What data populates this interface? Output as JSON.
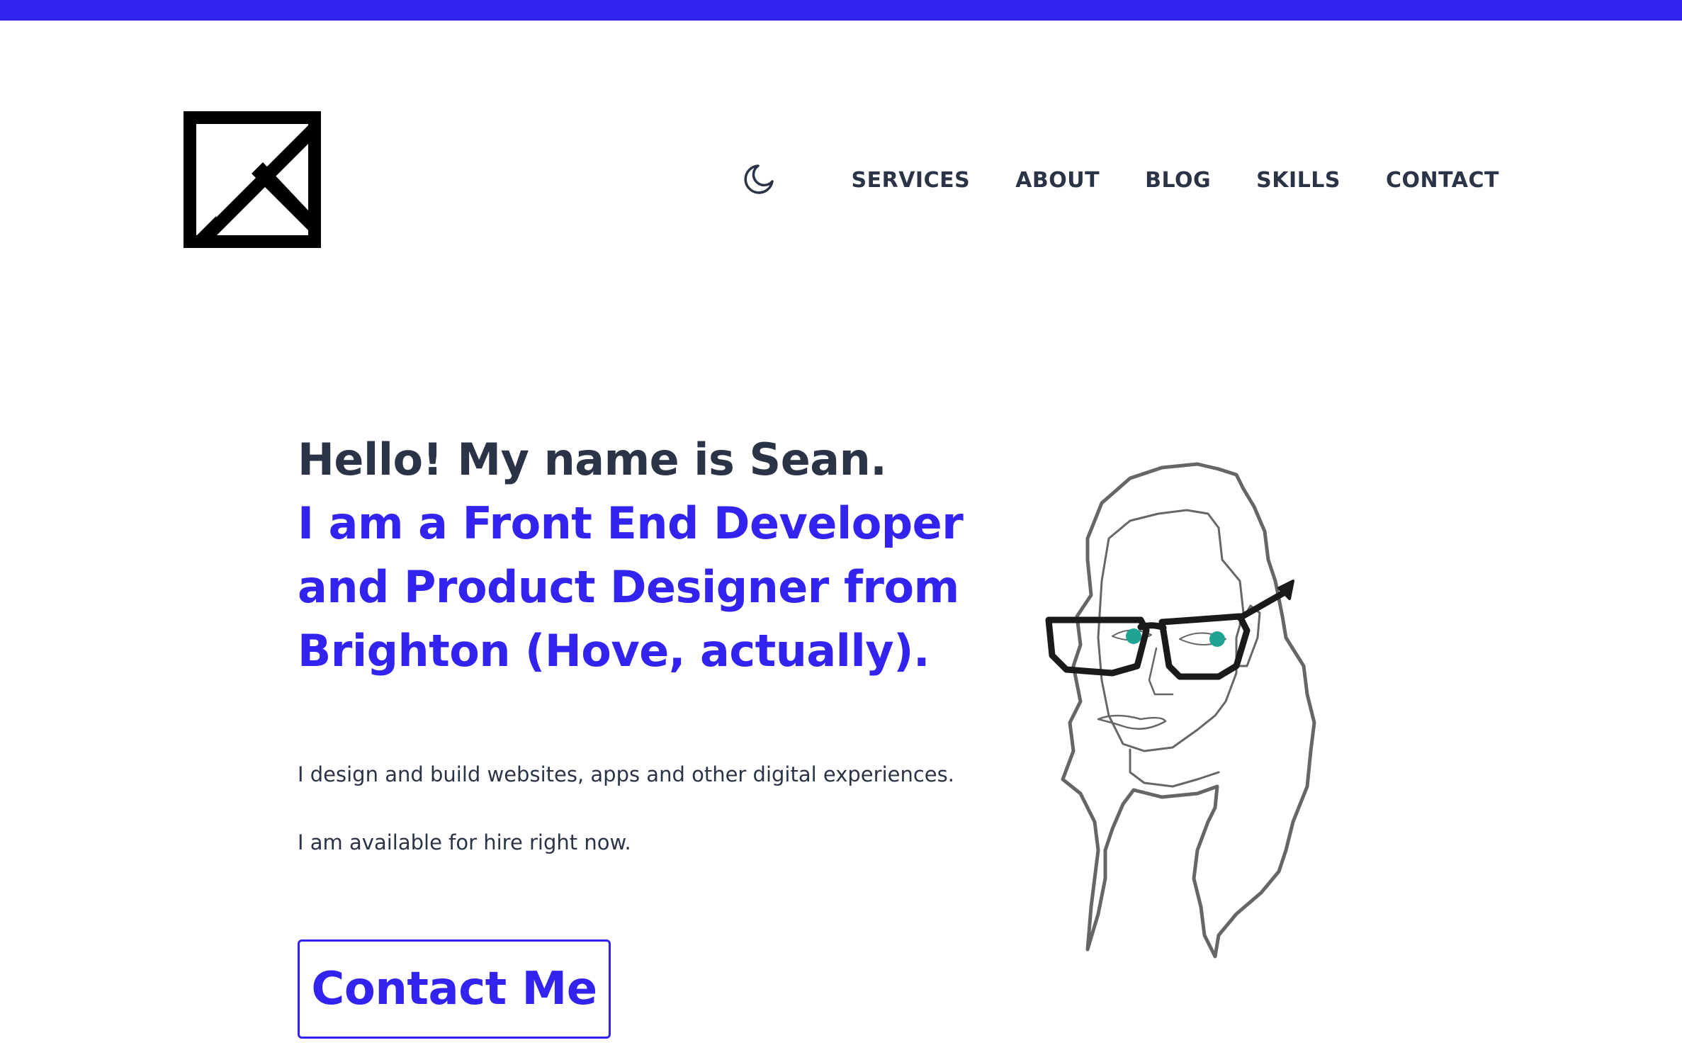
{
  "header": {
    "logo_icon": "k-square-logo-icon",
    "theme_toggle_icon": "moon-icon",
    "nav": [
      {
        "label": "SERVICES"
      },
      {
        "label": "ABOUT"
      },
      {
        "label": "BLOG"
      },
      {
        "label": "SKILLS"
      },
      {
        "label": "CONTACT"
      }
    ]
  },
  "hero": {
    "greeting": "Hello! My name is Sean.",
    "role": "I am a Front End Developer and Product Designer from Brighton (Hove, actually).",
    "intro": "I design and build websites, apps and other digital experiences.",
    "availability": "I am available for hire right now.",
    "cta_label": "Contact Me",
    "portrait_icon": "portrait-illustration"
  },
  "colors": {
    "accent": "#3223ee",
    "text": "#2b3446",
    "background": "#ffffff",
    "portrait_eye": "#1fa393"
  }
}
